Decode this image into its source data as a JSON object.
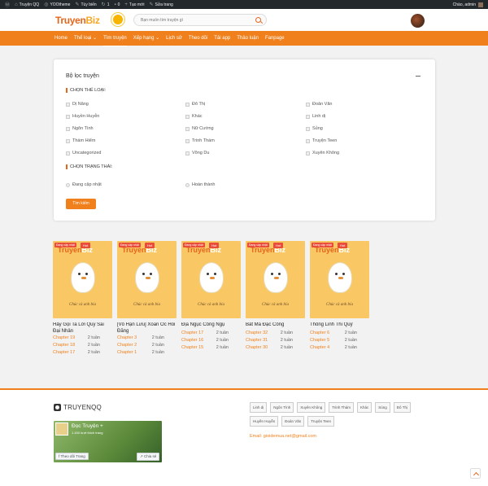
{
  "adminbar": {
    "items": [
      "Truyện QQ",
      "YOOtheme",
      "Tùy biến",
      "1",
      "0",
      "Tạo mới",
      "Sửa trang"
    ],
    "greeting": "Chào, admin"
  },
  "header": {
    "logo_a": "Truyen",
    "logo_b": "Biz",
    "search_placeholder": "Bạn muốn tìm truyện gì"
  },
  "nav": [
    "Home",
    "Thể loại",
    "Tìm truyện",
    "Xếp hạng",
    "Lịch sử",
    "Theo dõi",
    "Tải app",
    "Thảo luận",
    "Fanpage"
  ],
  "filter": {
    "title": "Bộ lọc truyện",
    "genre_heading": "CHỌN THỂ LOẠI:",
    "genres": [
      "Dị Năng",
      "Đô Thị",
      "Đoản Văn",
      "Huyền Huyễn",
      "Khác",
      "Linh dị",
      "Ngôn Tình",
      "Nữ Cường",
      "Sủng",
      "Thám Hiểm",
      "Trinh Thám",
      "Truyện Teen",
      "Uncategorized",
      "Võng Du",
      "Xuyên Không"
    ],
    "status_heading": "CHỌN TRẠNG THÁI:",
    "statuses": [
      "Đang cập nhật",
      "Hoàn thành"
    ],
    "search_button": "Tìm kiếm"
  },
  "cover": {
    "badge_updating": "Đang cập nhật",
    "badge_hot": "Hot",
    "logo_a": "Truyen",
    "logo_b": "Biz",
    "caption": "Chúc cả anh bía"
  },
  "novels": [
    {
      "title": "Hây Gọi Ta Lời Quý Sai Đại Nhân",
      "chapters": [
        {
          "c": "Chapter 19",
          "t": "2 tuần"
        },
        {
          "c": "Chapter 18",
          "t": "2 tuần"
        },
        {
          "c": "Chapter 17",
          "t": "2 tuần"
        }
      ]
    },
    {
      "title": "[Vô Hạn Lưu] Xoắn Ốc Hồi Đăng",
      "chapters": [
        {
          "c": "Chapter 3",
          "t": "2 tuần"
        },
        {
          "c": "Chapter 2",
          "t": "2 tuần"
        },
        {
          "c": "Chapter 1",
          "t": "2 tuần"
        }
      ]
    },
    {
      "title": "Địa Ngục Công Ngụ",
      "chapters": [
        {
          "c": "Chapter 17",
          "t": "2 tuần"
        },
        {
          "c": "Chapter 16",
          "t": "2 tuần"
        },
        {
          "c": "Chapter 15",
          "t": "2 tuần"
        }
      ]
    },
    {
      "title": "Bất Ma Đặc Công",
      "chapters": [
        {
          "c": "Chapter 32",
          "t": "2 tuần"
        },
        {
          "c": "Chapter 31",
          "t": "2 tuần"
        },
        {
          "c": "Chapter 30",
          "t": "2 tuần"
        }
      ]
    },
    {
      "title": "Thông Linh Thi Quỷ",
      "chapters": [
        {
          "c": "Chapter 6",
          "t": "2 tuần"
        },
        {
          "c": "Chapter 5",
          "t": "2 tuần"
        },
        {
          "c": "Chapter 4",
          "t": "2 tuần"
        }
      ]
    }
  ],
  "footer": {
    "logo": "TRUYENQQ",
    "fb_name": "Đọc Truyện +",
    "fb_likes": "1.430 lượt thích trang",
    "fb_follow": "Theo dõi Trang",
    "fb_share": "Chia sẻ",
    "tags": [
      "Linh dị",
      "Ngôn Tình",
      "Xuyên Không",
      "Trinh Thám",
      "Khác",
      "Sủng",
      "Đô Thị",
      "Huyền Huyễn",
      "Đoản Văn",
      "Truyện Teen"
    ],
    "email": "Email: gioidemua.net@gmail.com"
  }
}
